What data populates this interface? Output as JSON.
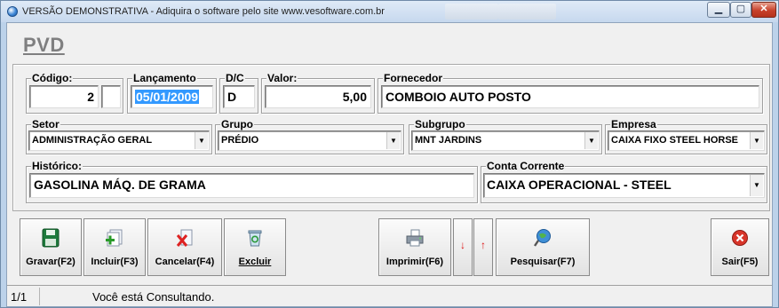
{
  "window": {
    "title": "VERSÃO DEMONSTRATIVA - Adiquira o software pelo site www.vesoftware.com.br",
    "minimize_glyph": "▁",
    "maximize_glyph": "▢",
    "close_glyph": "✕"
  },
  "screen_title": "PVD",
  "fields": {
    "codigo": {
      "label": "Código:",
      "value": "2",
      "suffix": ""
    },
    "lancamento": {
      "label": "Lançamento",
      "value": "05/01/2009"
    },
    "dc": {
      "label": "D/C",
      "value": "D"
    },
    "valor": {
      "label": "Valor:",
      "value": "5,00"
    },
    "fornecedor": {
      "label": "Fornecedor",
      "value": "COMBOIO AUTO POSTO"
    },
    "setor": {
      "label": "Setor",
      "value": "ADMINISTRAÇÃO GERAL"
    },
    "grupo": {
      "label": "Grupo",
      "value": "PRÉDIO"
    },
    "subgrupo": {
      "label": "Subgrupo",
      "value": "MNT JARDINS"
    },
    "empresa": {
      "label": "Empresa",
      "value": "CAIXA FIXO STEEL HORSE"
    },
    "historico": {
      "label": "Histórico:",
      "value": "GASOLINA MÁQ. DE GRAMA"
    },
    "conta_corrente": {
      "label": "Conta Corrente",
      "value": "CAIXA OPERACIONAL - STEEL"
    }
  },
  "dropdown_glyph": "▼",
  "toolbar": {
    "gravar": "Gravar(F2)",
    "incluir": "Incluir(F3)",
    "cancelar": "Cancelar(F4)",
    "excluir": "Excluir",
    "imprimir": "Imprimir(F6)",
    "down_glyph": "↓",
    "up_glyph": "↑",
    "pesquisar": "Pesquisar(F7)",
    "sair": "Sair(F5)"
  },
  "icons": {
    "gravar": "floppy-disk-icon",
    "incluir": "add-document-icon",
    "cancelar": "cancel-document-icon",
    "excluir": "recycle-bin-icon",
    "imprimir": "printer-icon",
    "pesquisar": "search-globe-icon",
    "sair": "exit-icon"
  },
  "status": {
    "page": "1/1",
    "message": "Você está Consultando."
  },
  "colors": {
    "selection": "#3399ff",
    "title_gray": "#7f7f80",
    "arrow_red": "#dd1111"
  }
}
